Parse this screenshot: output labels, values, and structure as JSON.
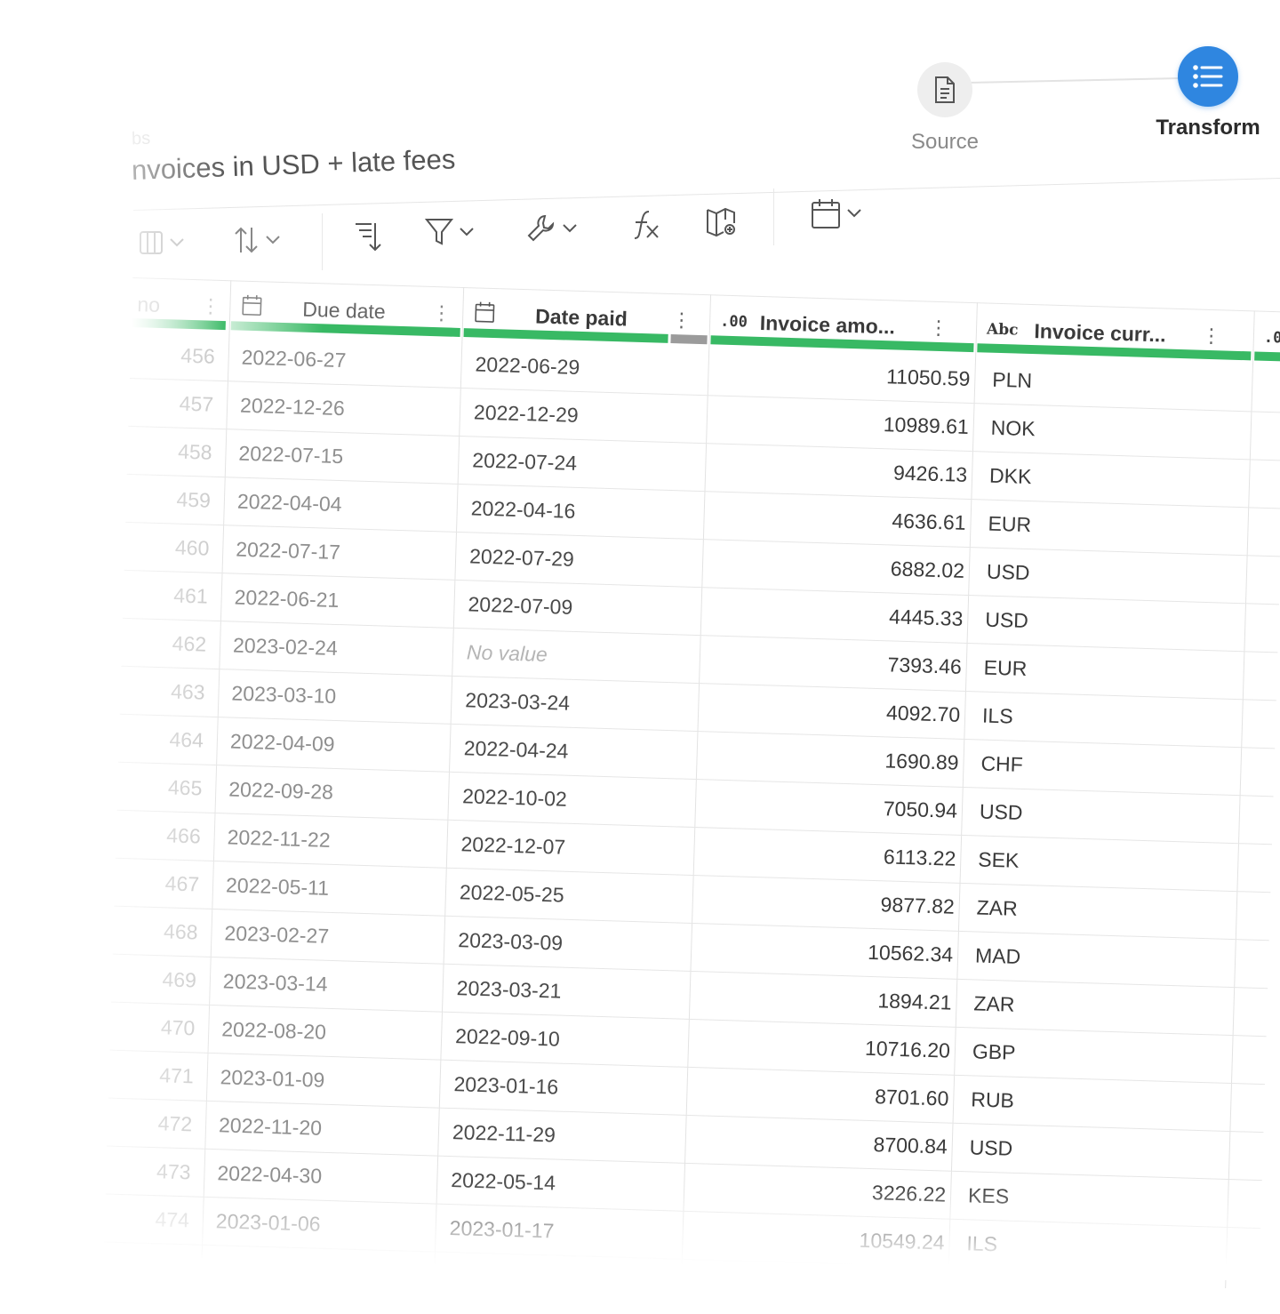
{
  "stepper": {
    "source_label": "Source",
    "transform_label": "Transform"
  },
  "header": {
    "tab_label": "bs",
    "title": "nvoices in USD + late fees"
  },
  "toolbar": {
    "icons": [
      "columns-icon",
      "sort-icon",
      "sort-descending-icon",
      "filter-icon",
      "wrench-icon",
      "formula-icon",
      "map-icon",
      "calendar-icon"
    ]
  },
  "table": {
    "headers": {
      "index": "no",
      "due_date": "Due date",
      "date_paid": "Date paid",
      "amount_type": ".00",
      "amount": "Invoice amo...",
      "currency_type": "Abc",
      "currency": "Invoice curr...",
      "next_type": ".0"
    },
    "column_status": {
      "due_date": "valid",
      "date_paid": "valid",
      "amount": "valid",
      "currency": "valid"
    },
    "rows": [
      {
        "idx": "456",
        "due": "2022-06-27",
        "paid": "2022-06-29",
        "amount": "11050.59",
        "currency": "PLN"
      },
      {
        "idx": "457",
        "due": "2022-12-26",
        "paid": "2022-12-29",
        "amount": "10989.61",
        "currency": "NOK"
      },
      {
        "idx": "458",
        "due": "2022-07-15",
        "paid": "2022-07-24",
        "amount": "9426.13",
        "currency": "DKK"
      },
      {
        "idx": "459",
        "due": "2022-04-04",
        "paid": "2022-04-16",
        "amount": "4636.61",
        "currency": "EUR"
      },
      {
        "idx": "460",
        "due": "2022-07-17",
        "paid": "2022-07-29",
        "amount": "6882.02",
        "currency": "USD"
      },
      {
        "idx": "461",
        "due": "2022-06-21",
        "paid": "2022-07-09",
        "amount": "4445.33",
        "currency": "USD"
      },
      {
        "idx": "462",
        "due": "2023-02-24",
        "paid": "No value",
        "amount": "7393.46",
        "currency": "EUR"
      },
      {
        "idx": "463",
        "due": "2023-03-10",
        "paid": "2023-03-24",
        "amount": "4092.70",
        "currency": "ILS"
      },
      {
        "idx": "464",
        "due": "2022-04-09",
        "paid": "2022-04-24",
        "amount": "1690.89",
        "currency": "CHF"
      },
      {
        "idx": "465",
        "due": "2022-09-28",
        "paid": "2022-10-02",
        "amount": "7050.94",
        "currency": "USD"
      },
      {
        "idx": "466",
        "due": "2022-11-22",
        "paid": "2022-12-07",
        "amount": "6113.22",
        "currency": "SEK"
      },
      {
        "idx": "467",
        "due": "2022-05-11",
        "paid": "2022-05-25",
        "amount": "9877.82",
        "currency": "ZAR"
      },
      {
        "idx": "468",
        "due": "2023-02-27",
        "paid": "2023-03-09",
        "amount": "10562.34",
        "currency": "MAD"
      },
      {
        "idx": "469",
        "due": "2023-03-14",
        "paid": "2023-03-21",
        "amount": "1894.21",
        "currency": "ZAR"
      },
      {
        "idx": "470",
        "due": "2022-08-20",
        "paid": "2022-09-10",
        "amount": "10716.20",
        "currency": "GBP"
      },
      {
        "idx": "471",
        "due": "2023-01-09",
        "paid": "2023-01-16",
        "amount": "8701.60",
        "currency": "RUB"
      },
      {
        "idx": "472",
        "due": "2022-11-20",
        "paid": "2022-11-29",
        "amount": "8700.84",
        "currency": "USD"
      },
      {
        "idx": "473",
        "due": "2022-04-30",
        "paid": "2022-05-14",
        "amount": "3226.22",
        "currency": "KES"
      },
      {
        "idx": "474",
        "due": "2023-01-06",
        "paid": "2023-01-17",
        "amount": "10549.24",
        "currency": "ILS"
      }
    ]
  },
  "colors": {
    "accent_blue": "#2f86e0",
    "valid_green": "#38b964",
    "partial_gray": "#9b9b9b"
  }
}
